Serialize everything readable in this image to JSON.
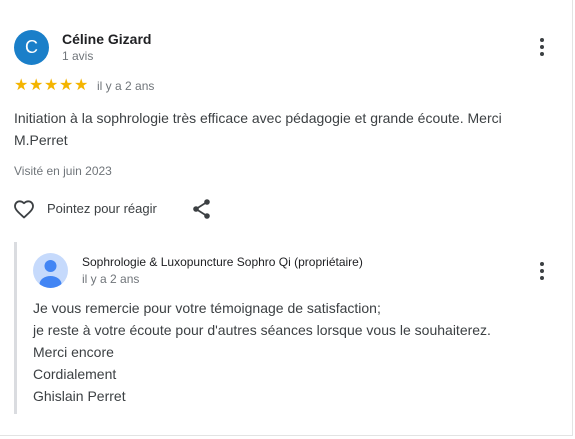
{
  "review": {
    "avatar_letter": "C",
    "avatar_color": "#1a7fc9",
    "reviewer_name": "Céline Gizard",
    "reviewer_meta": "1 avis",
    "rating": 5,
    "rating_max": 5,
    "star_color": "#f4b400",
    "time": "il y a 2 ans",
    "text": "Initiation à la sophrologie très efficace avec pédagogie et grande écoute. Merci M.Perret",
    "visited": "Visité en juin 2023",
    "like_label": "Pointez pour réagir",
    "icons": [
      "more-vert-icon",
      "heart-outline-icon",
      "share-icon"
    ]
  },
  "owner_reply": {
    "owner_name": "Sophrologie & Luxopuncture Sophro Qi (propriétaire)",
    "time": "il y a 2 ans",
    "lines": [
      "Je vous remercie pour votre témoignage de satisfaction;",
      "je reste à votre écoute pour d'autres séances lorsque vous le souhaiterez.",
      "Merci encore",
      "Cordialement",
      "Ghislain Perret"
    ],
    "icons": [
      "person-avatar-icon",
      "more-vert-icon"
    ]
  }
}
